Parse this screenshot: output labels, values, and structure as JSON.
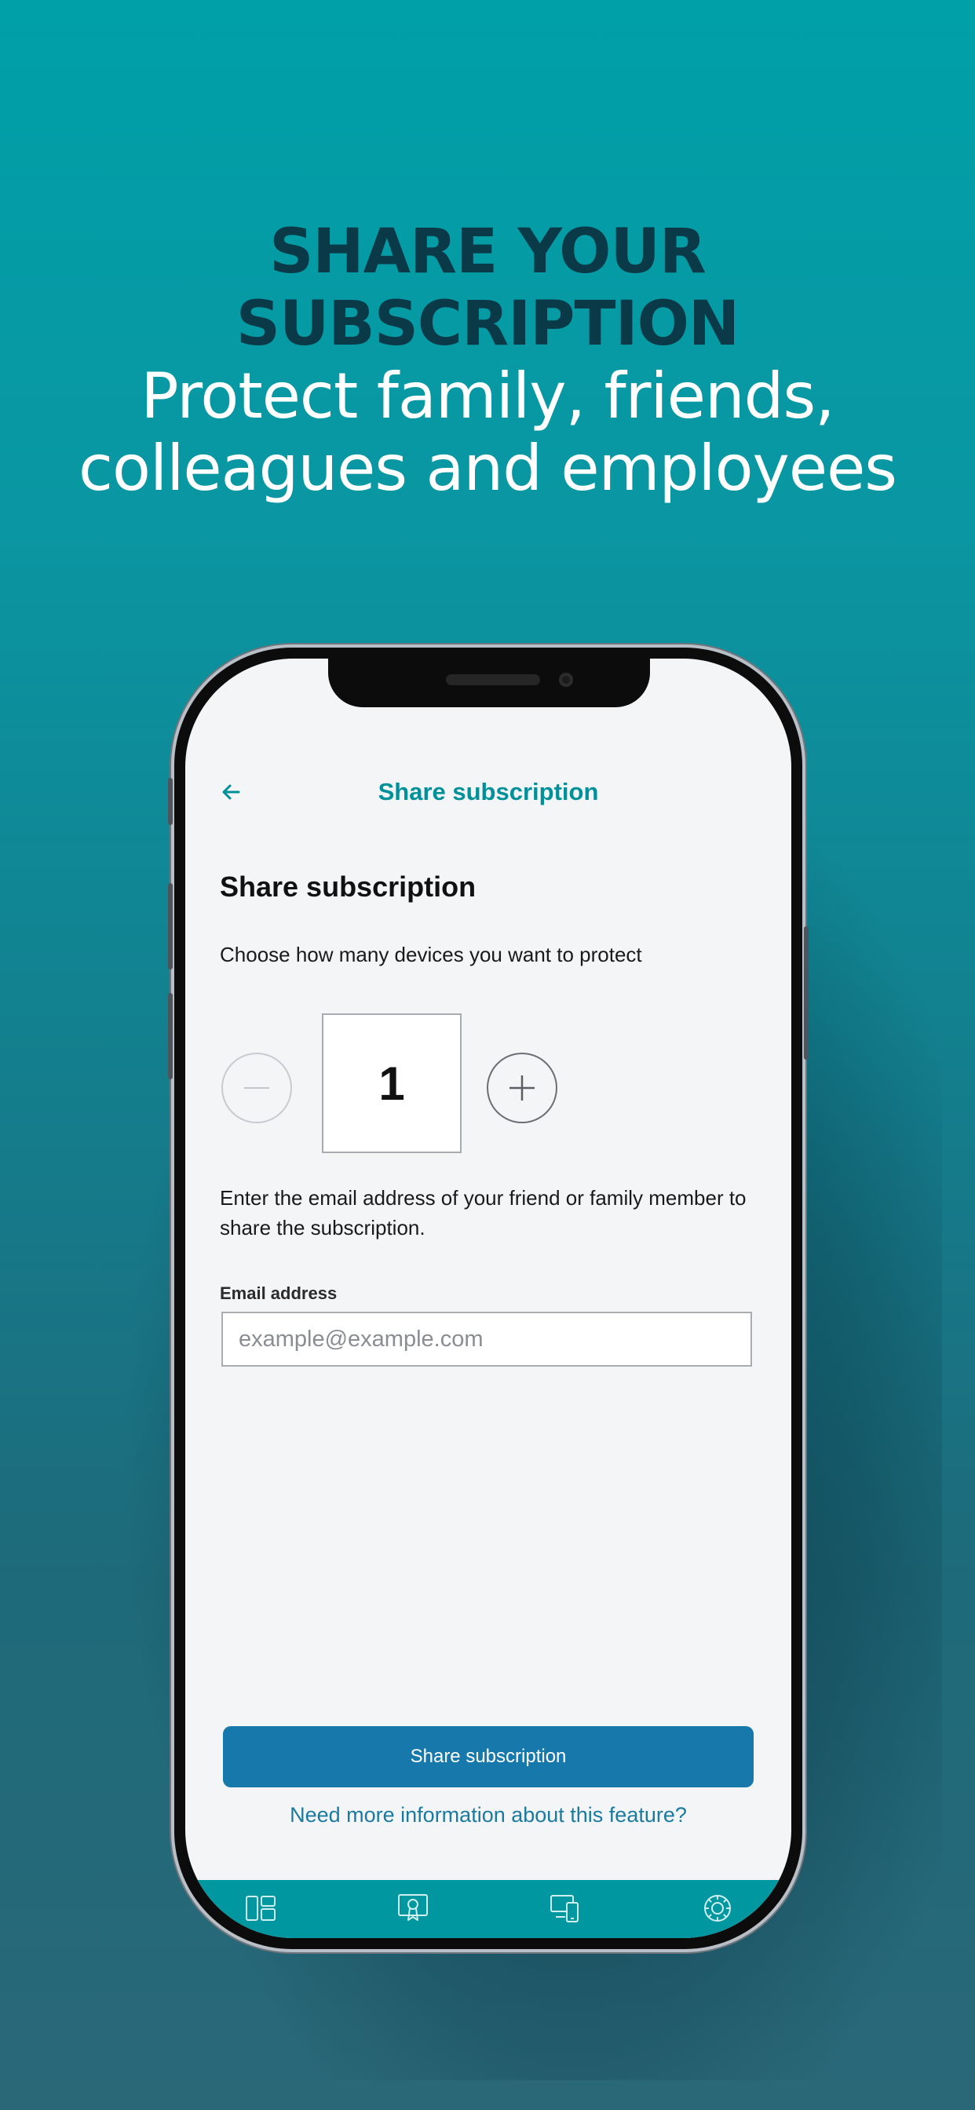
{
  "promo": {
    "headline_line1": "SHARE YOUR",
    "headline_line2": "SUBSCRIPTION",
    "subline_line1": "Protect family, friends,",
    "subline_line2": "colleagues and employees"
  },
  "header": {
    "back_icon": "arrow-left-icon",
    "title": "Share subscription"
  },
  "main": {
    "title": "Share subscription",
    "device_prompt": "Choose how many devices you want to protect",
    "device_count": "1",
    "email_instructions": "Enter the email address of your friend or family member to share the subscription.",
    "email_label": "Email address",
    "email_value": "",
    "email_placeholder": "example@example.com",
    "share_button_label": "Share subscription",
    "info_link": "Need more information about this feature?"
  },
  "tabbar": {
    "tabs": [
      {
        "icon": "dashboard-icon"
      },
      {
        "icon": "license-certificate-icon"
      },
      {
        "icon": "devices-icon"
      },
      {
        "icon": "settings-gear-icon"
      }
    ]
  },
  "colors": {
    "accent": "#00909a",
    "primary_button": "#1779ab",
    "link": "#1a7aa0",
    "tabbar": "#0097a0",
    "headline": "#0a3a48"
  }
}
